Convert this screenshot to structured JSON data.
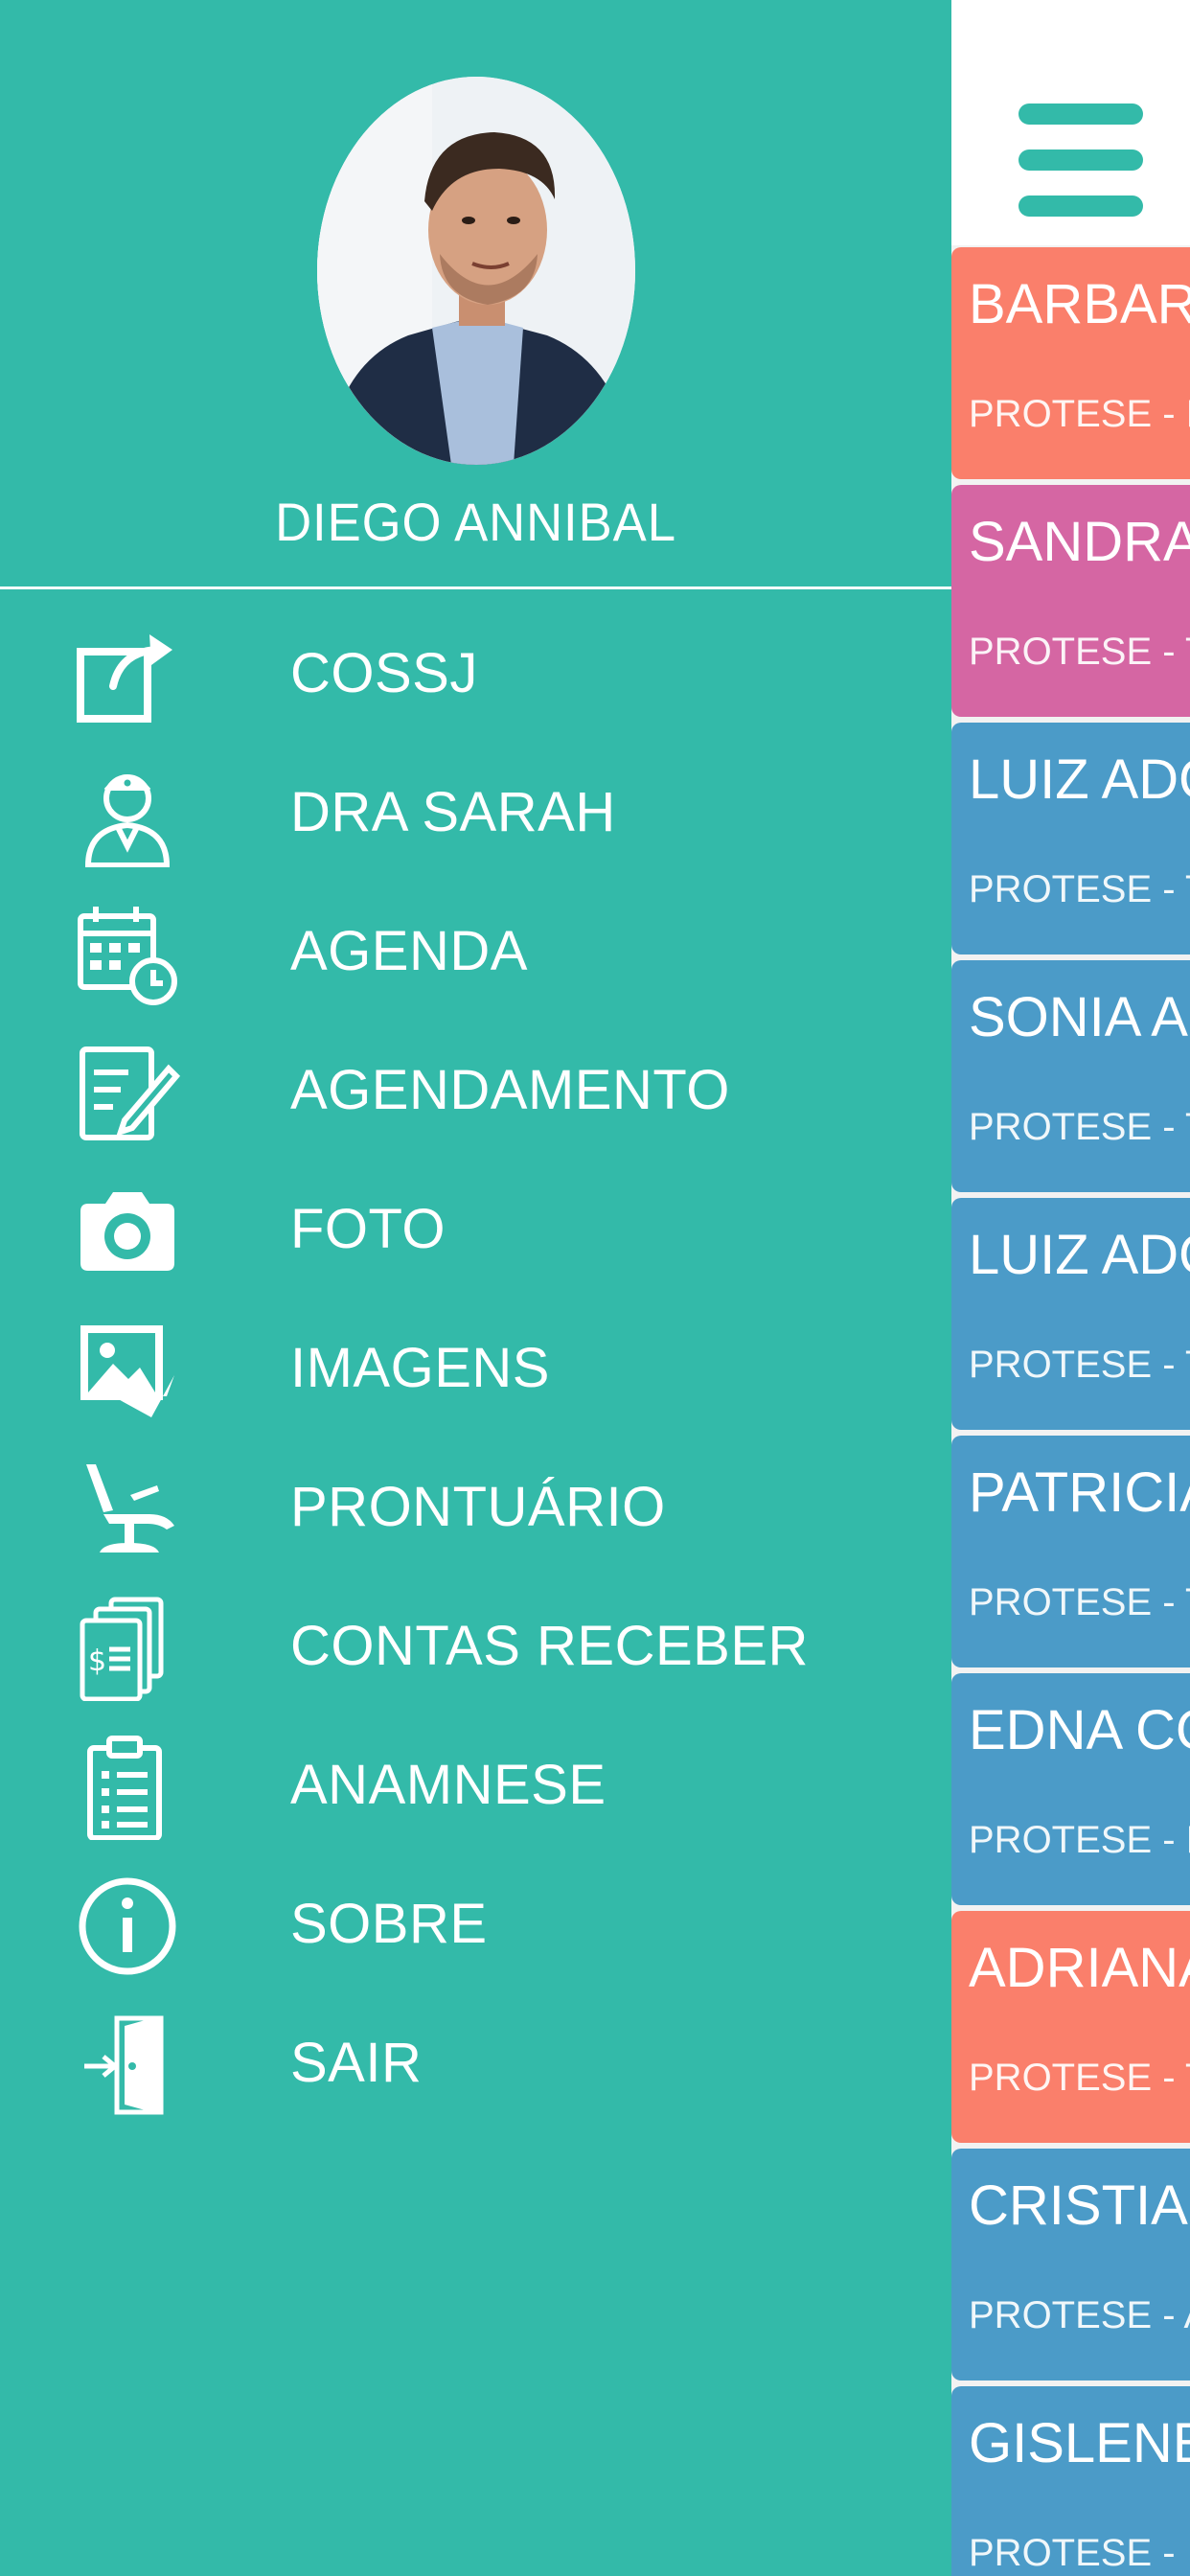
{
  "user": {
    "name": "DIEGO ANNIBAL",
    "avatar": "profile-photo"
  },
  "menu": {
    "items": [
      {
        "label": "COSSJ",
        "icon": "share-icon"
      },
      {
        "label": "DRA SARAH",
        "icon": "doctor-icon"
      },
      {
        "label": "AGENDA",
        "icon": "calendar-clock-icon"
      },
      {
        "label": "AGENDAMENTO",
        "icon": "edit-document-icon"
      },
      {
        "label": "FOTO",
        "icon": "camera-icon"
      },
      {
        "label": "IMAGENS",
        "icon": "images-icon"
      },
      {
        "label": "PRONTUÁRIO",
        "icon": "dental-chair-icon"
      },
      {
        "label": "CONTAS RECEBER",
        "icon": "invoice-icon"
      },
      {
        "label": "ANAMNESE",
        "icon": "clipboard-list-icon"
      },
      {
        "label": "SOBRE",
        "icon": "info-icon"
      },
      {
        "label": "SAIR",
        "icon": "exit-door-icon"
      }
    ]
  },
  "patients": {
    "items": [
      {
        "name": "BARBARA",
        "desc": "PROTESE - F",
        "color": "#fa7f6b"
      },
      {
        "name": "SANDRA",
        "desc": "PROTESE - T",
        "color": "#d566a3"
      },
      {
        "name": "LUIZ ADO",
        "desc": "PROTESE - T",
        "color": "#4b9bc8"
      },
      {
        "name": "SONIA AP",
        "desc": "PROTESE - T",
        "color": "#4b9bc8"
      },
      {
        "name": "LUIZ ADO",
        "desc": "PROTESE - T",
        "color": "#4b9bc8"
      },
      {
        "name": "PATRICIA",
        "desc": "PROTESE - T",
        "color": "#4b9bc8"
      },
      {
        "name": "EDNA CO",
        "desc": "PROTESE - F",
        "color": "#4b9bc8"
      },
      {
        "name": "ADRIANA",
        "desc": "PROTESE - T",
        "color": "#fa7f6b"
      },
      {
        "name": "CRISTIAN",
        "desc": "PROTESE - A",
        "color": "#4b9bc8"
      },
      {
        "name": "GISLENE",
        "desc": "PROTESE - ",
        "color": "#4b9bc8"
      }
    ]
  },
  "colors": {
    "drawer": "#33baa9",
    "white": "#ffffff",
    "card_blue": "#4b9bc8",
    "card_coral": "#fa7f6b",
    "card_pink": "#d566a3"
  },
  "icons": {
    "menu": "hamburger-icon"
  }
}
